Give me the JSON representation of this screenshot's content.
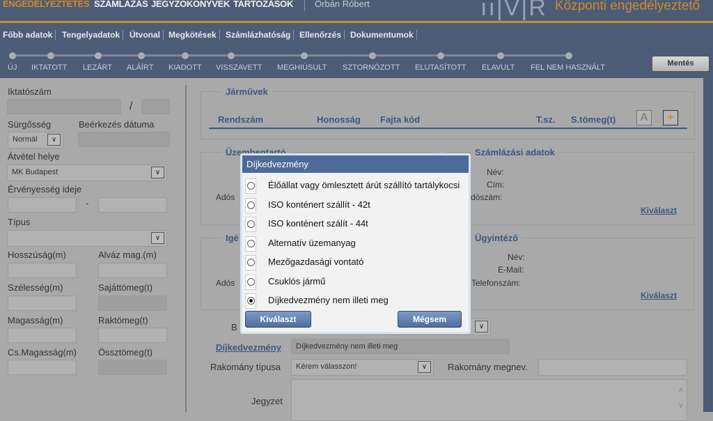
{
  "header": {
    "menu": [
      "ENGEDÉLYEZTETÉS",
      "SZÁMLÁZÁS",
      "JEGYZŐKÖNYVEK",
      "TARTOZÁSOK"
    ],
    "user": "Orbán Róbert",
    "logo": "ÁKR",
    "app_title": "Központi engedélyeztető"
  },
  "subnav": [
    "Főbb adatok",
    "Tengelyadatok",
    "Útvonal",
    "Megkötések",
    "Számlázhatóság",
    "Ellenőrzés",
    "Dokumentumok"
  ],
  "steps": [
    "ÚJ",
    "IKTATOTT",
    "LEZÁRT",
    "ALÁÍRT",
    "KIADOTT",
    "VISSZAVETT",
    "MEGHIÚSULT",
    "SZTORNÓZOTT",
    "ELUTASÍTOTT",
    "ELAVULT",
    "FEL NEM HASZNÁLT"
  ],
  "save_label": "Mentés",
  "left": {
    "iktatoszam": "Iktatószám",
    "slash": "/",
    "surgosseg": "Sürgősség",
    "surgosseg_value": "Normál",
    "beerkezes": "Beérkezés dátuma",
    "atvetel": "Átvétel helye",
    "atvetel_value": "MK Budapest",
    "ervenyesseg": "Érvényesség ideje",
    "dash": "-",
    "tipus": "Típus",
    "hossz": "Hosszúság(m)",
    "alvaz": "Alváz mag.(m)",
    "szelesseg": "Szélesség(m)",
    "sajattomeg": "Sajáttömeg(t)",
    "magassag": "Magasság(m)",
    "raktomeg": "Raktömeg(t)",
    "csmagassag": "Cs.Magasság(m)",
    "ossztomeg": "Össztömeg(t)"
  },
  "jarmuvek": {
    "title": "Járművek",
    "cols": [
      "Rendszám",
      "Honosság",
      "Fajta kód",
      "T.sz.",
      "S.tömeg(t)"
    ],
    "btn_a": "A",
    "btn_add": "+"
  },
  "uzembentarto": {
    "title": "Üzembentartó",
    "partial": "Adós"
  },
  "szamlazasi": {
    "title": "Számlázási adatok",
    "nev": "Név:",
    "cim": "Cím:",
    "adoszam": "dószám:",
    "link": "Kiválaszt"
  },
  "igenylo": {
    "title": "Igé",
    "partial": "Adós"
  },
  "ugyintezo": {
    "title": "Ügyintéző",
    "nev": "Név:",
    "email": "E-Mail:",
    "tel": "Telefonszám:",
    "link": "Kiválaszt"
  },
  "bottom": {
    "b_partial": "B",
    "dij_label": "Díjkedvezmény",
    "dij_value": "Díjkedvezmény nem illeti meg",
    "rak_tipus": "Rakomány típusa",
    "rak_tipus_value": "Kérem válasszon!",
    "rak_megnev": "Rakomány megnev.",
    "jegyzet": "Jegyzet"
  },
  "modal": {
    "title": "Díjkedvezmény",
    "options": [
      "Élőállat vagy ömlesztett árút szállító tartálykocsi",
      "ISO konténert szállít - 42t",
      "ISO konténert szálít - 44t",
      "Alternatív üzemanyag",
      "Mezőgazdasági vontató",
      "Csuklós jármű",
      "Díjkedvezmény nem illeti meg"
    ],
    "selected": 6,
    "select_label": "Kiválaszt",
    "cancel_label": "Mégsem"
  }
}
